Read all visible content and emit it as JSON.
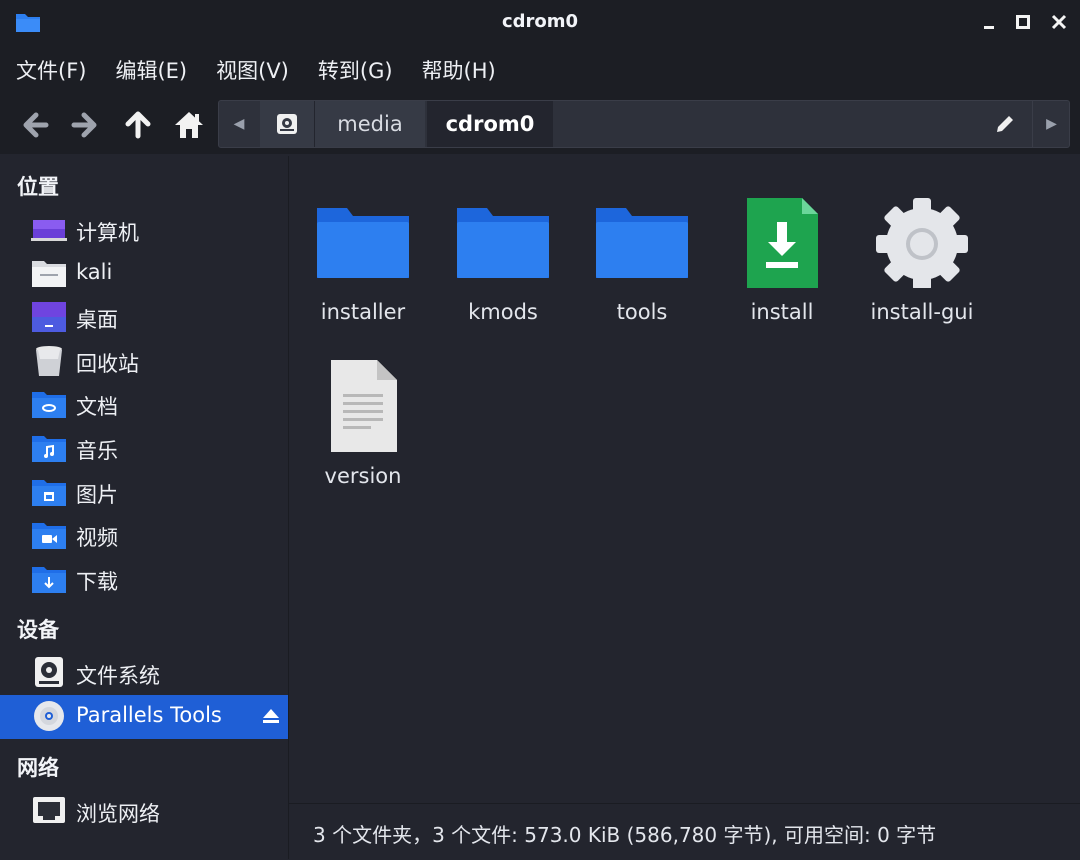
{
  "window": {
    "title": "cdrom0"
  },
  "menu": [
    "文件(F)",
    "编辑(E)",
    "视图(V)",
    "转到(G)",
    "帮助(H)"
  ],
  "path": {
    "segments": [
      "media",
      "cdrom0"
    ]
  },
  "sidebar": {
    "places_header": "位置",
    "places": [
      {
        "label": "计算机",
        "icon": "computer-icon"
      },
      {
        "label": "kali",
        "icon": "home-folder-icon"
      },
      {
        "label": "桌面",
        "icon": "desktop-icon"
      },
      {
        "label": "回收站",
        "icon": "trash-icon"
      },
      {
        "label": "文档",
        "icon": "documents-folder-icon"
      },
      {
        "label": "音乐",
        "icon": "music-folder-icon"
      },
      {
        "label": "图片",
        "icon": "pictures-folder-icon"
      },
      {
        "label": "视频",
        "icon": "videos-folder-icon"
      },
      {
        "label": "下载",
        "icon": "downloads-folder-icon"
      }
    ],
    "devices_header": "设备",
    "devices": [
      {
        "label": "文件系统",
        "icon": "drive-icon"
      },
      {
        "label": "Parallels Tools",
        "icon": "optical-disc-icon",
        "selected": true
      }
    ],
    "network_header": "网络",
    "network": [
      {
        "label": "浏览网络",
        "icon": "network-icon"
      }
    ]
  },
  "files": [
    {
      "name": "installer",
      "type": "folder"
    },
    {
      "name": "kmods",
      "type": "folder"
    },
    {
      "name": "tools",
      "type": "folder"
    },
    {
      "name": "install",
      "type": "package"
    },
    {
      "name": "install-gui",
      "type": "executable"
    },
    {
      "name": "version",
      "type": "text"
    }
  ],
  "status": "3 个文件夹，3 个文件: 573.0 KiB (586,780 字节), 可用空间: 0 字节",
  "colors": {
    "accent": "#1f5fd6",
    "folder": "#2d7ff0",
    "background": "#23252e",
    "header": "#1c1e24"
  }
}
